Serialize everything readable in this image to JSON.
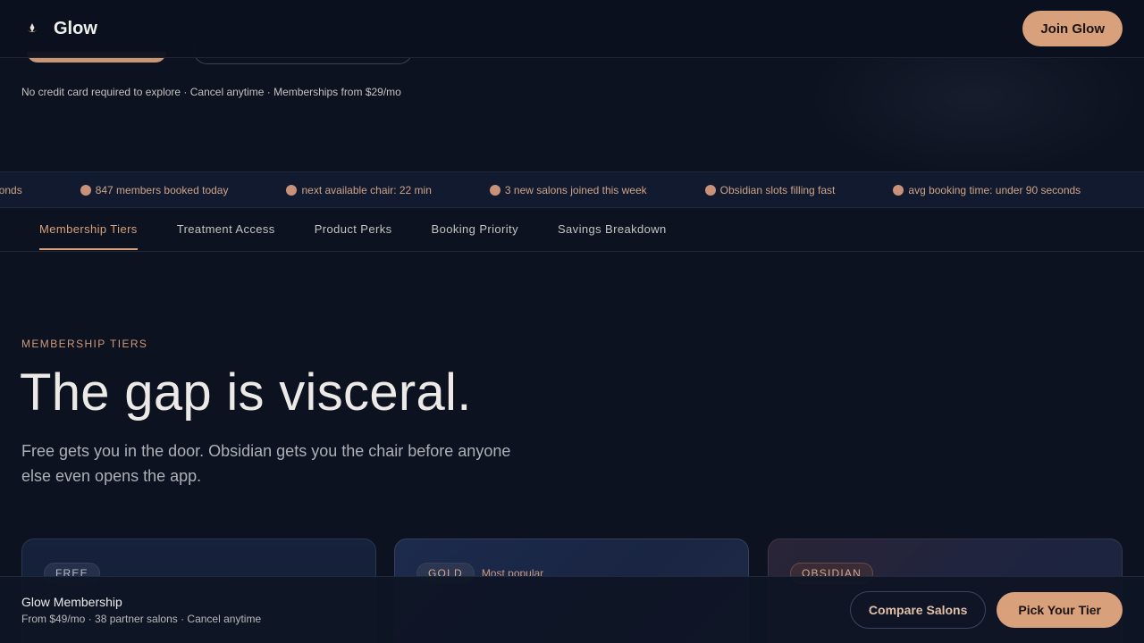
{
  "header": {
    "brand": "Glow",
    "join_label": "Join Glow"
  },
  "hero": {
    "fineprint": "No credit card required to explore · Cancel anytime · Memberships from $29/mo"
  },
  "ticker": {
    "items": [
      "seconds",
      "847 members booked today",
      "next available chair: 22 min",
      "3 new salons joined this week",
      "Obsidian slots filling fast",
      "avg booking time: under 90 seconds"
    ]
  },
  "tabs": [
    {
      "label": "Membership Tiers"
    },
    {
      "label": "Treatment Access"
    },
    {
      "label": "Product Perks"
    },
    {
      "label": "Booking Priority"
    },
    {
      "label": "Savings Breakdown"
    }
  ],
  "section": {
    "eyebrow": "MEMBERSHIP TIERS",
    "headline": "The gap is visceral.",
    "subtext": "Free gets you in the door. Obsidian gets you the chair before anyone else even opens the app."
  },
  "tiers": [
    {
      "badge": "FREE"
    },
    {
      "badge": "GOLD",
      "tag": "Most popular"
    },
    {
      "badge": "OBSIDIAN"
    }
  ],
  "bottom_bar": {
    "title": "Glow Membership",
    "meta": "From $49/mo · 38 partner salons · Cancel anytime",
    "compare_label": "Compare Salons",
    "pick_label": "Pick Your Tier"
  },
  "colors": {
    "background": "#0c1220",
    "accent": "#d9a07c"
  }
}
